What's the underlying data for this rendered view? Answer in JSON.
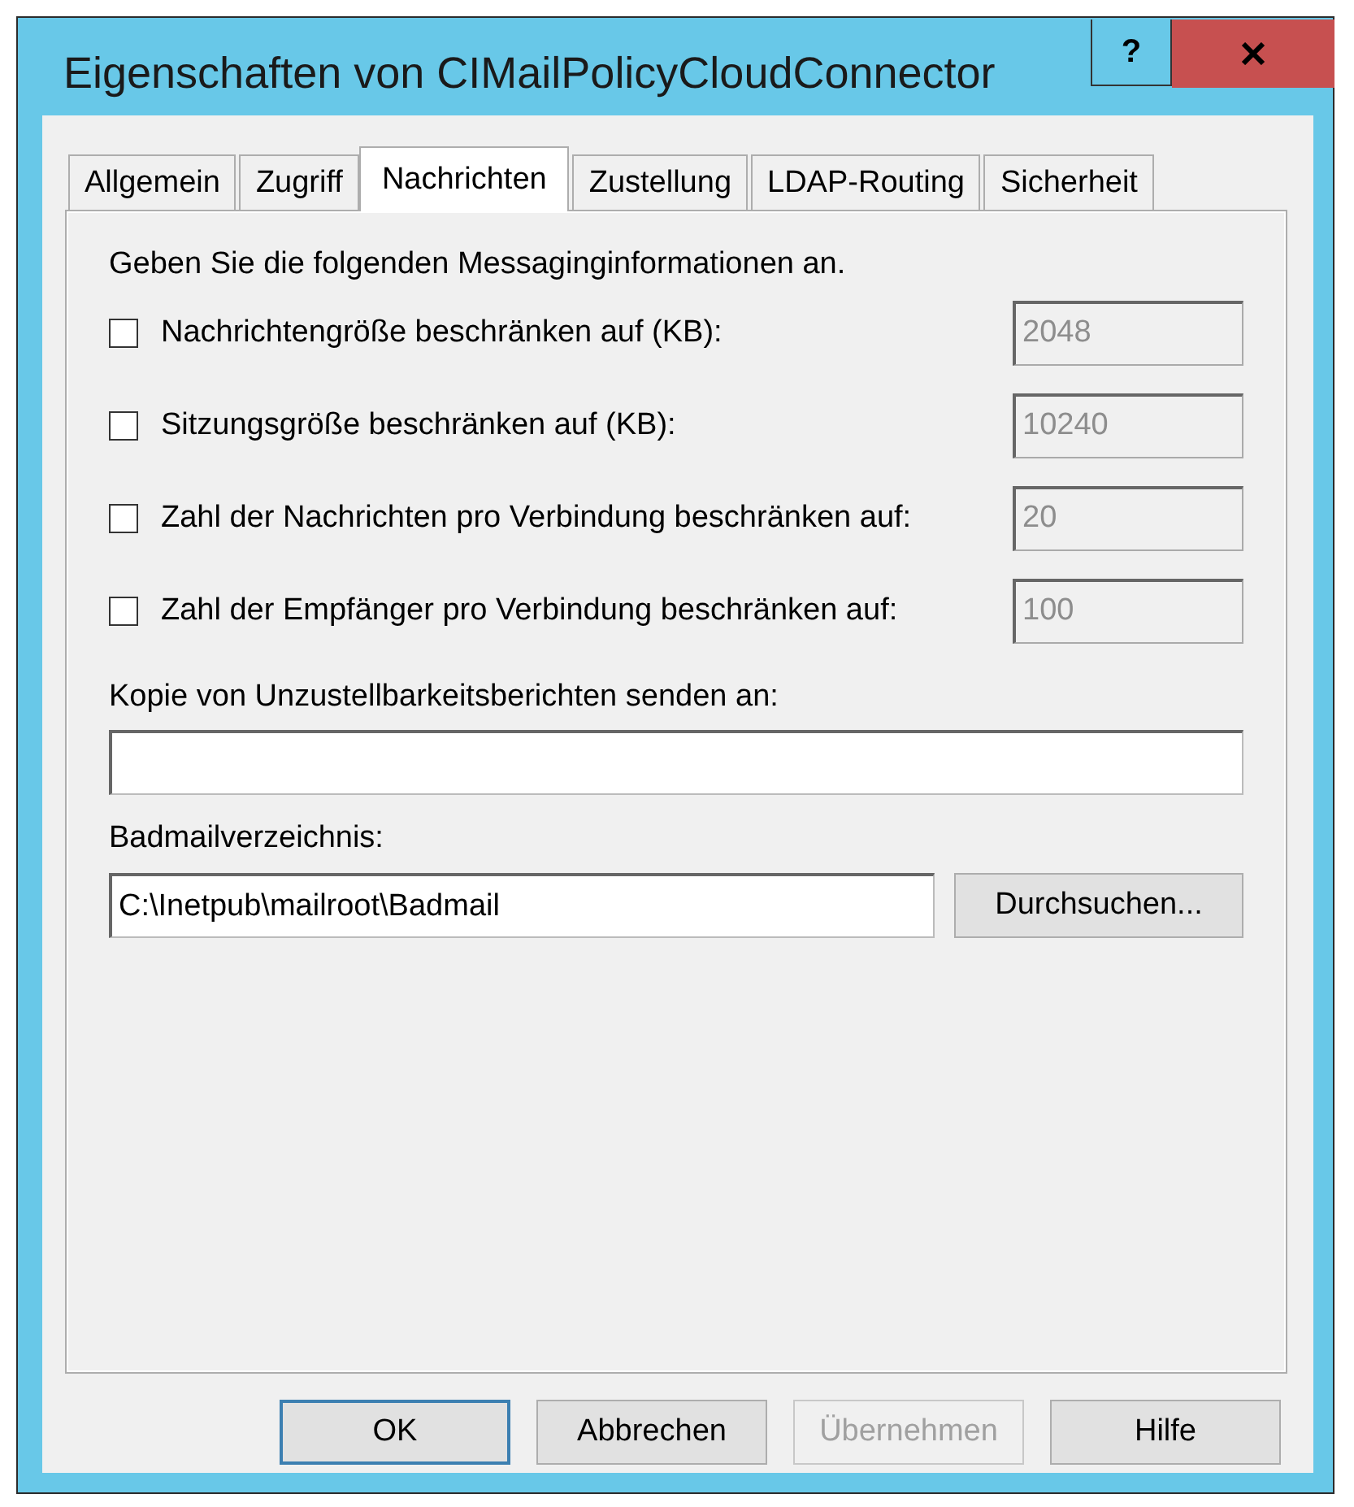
{
  "window": {
    "title": "Eigenschaften von CIMailPolicyCloudConnector"
  },
  "help_button": {
    "label": "?"
  },
  "tabs": [
    {
      "label": "Allgemein",
      "selected": false
    },
    {
      "label": "Zugriff",
      "selected": false
    },
    {
      "label": "Nachrichten",
      "selected": true
    },
    {
      "label": "Zustellung",
      "selected": false
    },
    {
      "label": "LDAP-Routing",
      "selected": false
    },
    {
      "label": "Sicherheit",
      "selected": false
    }
  ],
  "intro": "Geben Sie die folgenden Messaginginformationen an.",
  "limits": [
    {
      "label": "Nachrichtengröße beschränken auf (KB):",
      "checked": false,
      "value": "2048"
    },
    {
      "label": "Sitzungsgröße beschränken auf (KB):",
      "checked": false,
      "value": "10240"
    },
    {
      "label": "Zahl der Nachrichten pro Verbindung beschränken auf:",
      "checked": false,
      "value": "20"
    },
    {
      "label": "Zahl der Empfänger pro Verbindung beschränken auf:",
      "checked": false,
      "value": "100"
    }
  ],
  "ndr_copy": {
    "label": "Kopie von Unzustellbarkeitsberichten senden an:"
  },
  "badmail": {
    "label": "Badmailverzeichnis:",
    "value": "C:\\Inetpub\\mailroot\\Badmail",
    "browse_button": "Durchsuchen..."
  },
  "buttons": [
    {
      "label": "OK",
      "default": true,
      "disabled": false
    },
    {
      "label": "Abbrechen",
      "default": false,
      "disabled": false
    },
    {
      "label": "Übernehmen",
      "default": false,
      "disabled": true
    },
    {
      "label": "Hilfe",
      "default": false,
      "disabled": false
    }
  ]
}
